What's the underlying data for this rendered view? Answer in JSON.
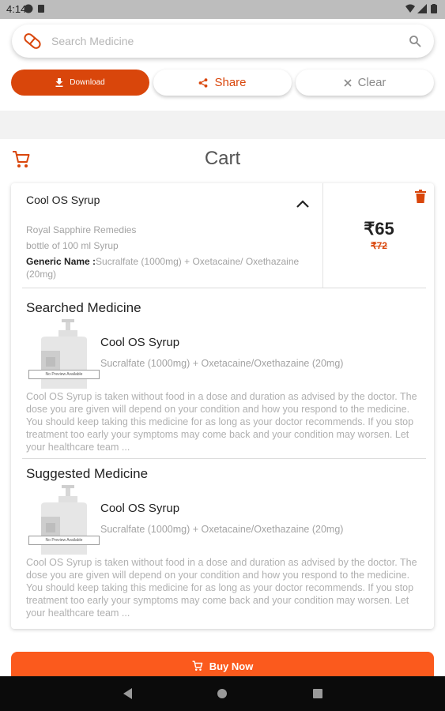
{
  "status_bar": {
    "time": "4:14"
  },
  "search": {
    "placeholder": "Search Medicine",
    "value": ""
  },
  "actions": {
    "download_label": "Download",
    "share_label": "Share",
    "clear_label": "Clear"
  },
  "cart": {
    "title": "Cart",
    "item": {
      "name": "Cool OS Syrup",
      "company": "Royal Sapphire Remedies",
      "pack": "bottle of 100 ml Syrup",
      "generic_label": "Generic Name :",
      "generic_value": "Sucralfate (1000mg) + Oxetacaine/ Oxethazaine (20mg)",
      "price": "₹65",
      "mrp": "₹72"
    },
    "searched": {
      "title": "Searched Medicine",
      "no_preview": "No Preview Available",
      "name": "Cool OS Syrup",
      "generic": "Sucralfate (1000mg) + Oxetacaine/Oxethazaine (20mg)",
      "description": "Cool OS Syrup is taken without food in a dose and duration as advised by the doctor. The dose you are given will depend on your condition and how you respond to the medicine. You should keep taking this medicine for as long as your doctor recommends. If you stop treatment too early your symptoms may come back and your condition may worsen. Let your healthcare team ..."
    },
    "suggested": {
      "title": "Suggested Medicine",
      "no_preview": "No Preview Available",
      "name": "Cool OS Syrup",
      "generic": "Sucralfate (1000mg) + Oxetacaine/Oxethazaine (20mg)",
      "description": "Cool OS Syrup is taken without food in a dose and duration as advised by the doctor. The dose you are given will depend on your condition and how you respond to the medicine. You should keep taking this medicine for as long as your doctor recommends. If you stop treatment too early your symptoms may come back and your condition may worsen. Let your healthcare team ..."
    }
  },
  "buy_now_label": "Buy Now",
  "colors": {
    "accent": "#d9460b",
    "buy_button": "#fb5a1d",
    "muted_text": "#a3a3a3"
  },
  "icons": [
    "pill-icon",
    "search-icon",
    "download-icon",
    "share-icon",
    "close-icon",
    "cart-icon",
    "chevron-up-icon",
    "delete-icon",
    "bottle-image",
    "back-icon",
    "home-icon",
    "recents-icon"
  ]
}
